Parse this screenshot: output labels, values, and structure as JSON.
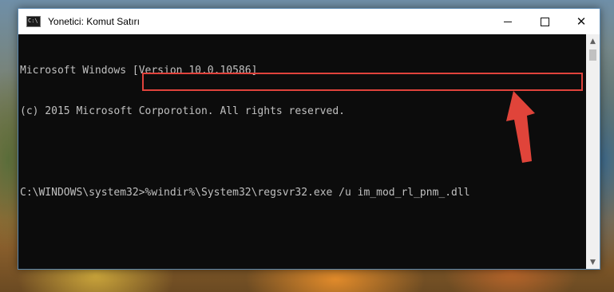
{
  "window": {
    "title": "Yonetici: Komut Satırı",
    "icon": "cmd-icon",
    "icon_text": "C:\\",
    "controls": {
      "minimize": "minimize-icon",
      "maximize": "maximize-icon",
      "close": "close-icon"
    }
  },
  "console": {
    "lines": [
      "Microsoft Windows [Version 10.0.10586]",
      "(c) 2015 Microsoft Corporotion. All rights reserved."
    ],
    "prompt": "C:\\WINDOWS\\system32>",
    "command": "%windir%\\System32\\regsvr32.exe /u im_mod_rl_pnm_.dll"
  },
  "scrollbar": {
    "up": "▲",
    "down": "▼"
  },
  "colors": {
    "highlight": "#e0433c",
    "arrow": "#e0443a",
    "console_bg": "#0c0c0c",
    "console_text": "#c0c0c0"
  }
}
